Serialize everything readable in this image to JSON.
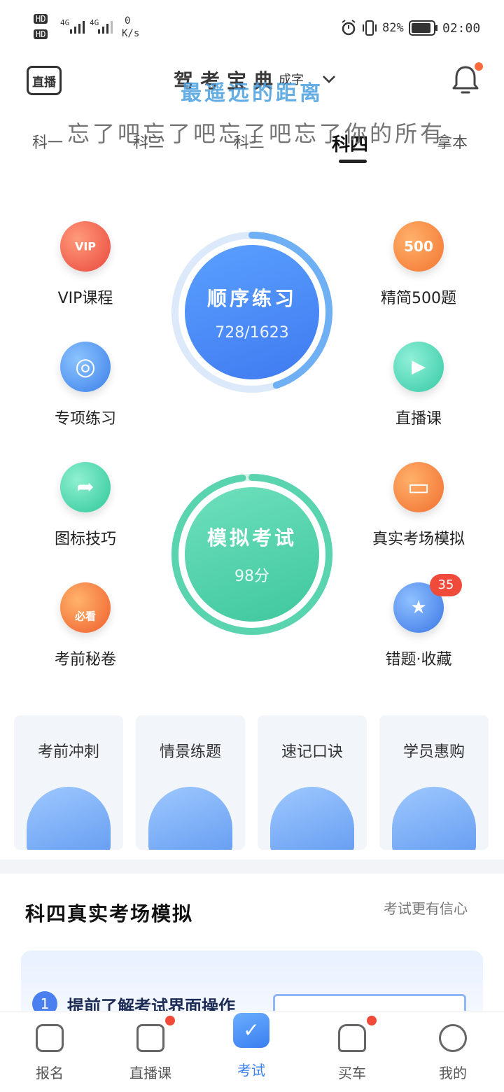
{
  "status_bar": {
    "hd1": "HD",
    "hd2": "HD",
    "net1": "4G",
    "net2": "4G",
    "speed_value": "0",
    "speed_unit": "K/s",
    "battery": "82%",
    "time": "02:00"
  },
  "header": {
    "live_label": "直播",
    "title": "驾考宝典",
    "title_overlay": "最遥远的距离",
    "title_sub": "成字"
  },
  "tabs": {
    "items": [
      "科一",
      "科二",
      "科三",
      "科四",
      "拿本"
    ],
    "active_index": 3,
    "overlay_text": "忘了吧忘了吧忘了吧忘了你的所有"
  },
  "features_left": [
    {
      "label": "VIP课程",
      "icon": "vip-medal-icon",
      "glyph": "VIP"
    },
    {
      "label": "专项练习",
      "icon": "target-icon",
      "glyph": "◎"
    },
    {
      "label": "图标技巧",
      "icon": "road-sign-icon",
      "glyph": "➦"
    },
    {
      "label": "考前秘卷",
      "icon": "exam-book-icon",
      "glyph": "必看"
    }
  ],
  "features_right": [
    {
      "label": "精简500题",
      "icon": "500-board-icon",
      "glyph": "500"
    },
    {
      "label": "直播课",
      "icon": "video-camera-icon",
      "glyph": "▶"
    },
    {
      "label": "真实考场模拟",
      "icon": "monitor-icon",
      "glyph": "▭"
    },
    {
      "label": "错题·收藏",
      "icon": "star-bookmark-icon",
      "glyph": "★",
      "badge": "35"
    }
  ],
  "practice": {
    "title": "顺序练习",
    "progress_text": "728/1623",
    "done": 728,
    "total": 1623
  },
  "mock_exam": {
    "title": "模拟考试",
    "score_text": "98分",
    "score": 98
  },
  "cards": [
    {
      "title": "考前冲刺"
    },
    {
      "title": "情景练题"
    },
    {
      "title": "速记口诀"
    },
    {
      "title": "学员惠购"
    }
  ],
  "section": {
    "title": "科四真实考场模拟",
    "more": "考试更有信心",
    "step_number": "1",
    "step_text": "提前了解考试界面操作"
  },
  "bottom_nav": [
    {
      "label": "报名",
      "icon": "signup-icon"
    },
    {
      "label": "直播课",
      "icon": "tv-icon",
      "dot": true
    },
    {
      "label": "考试",
      "icon": "check-icon",
      "active": true
    },
    {
      "label": "买车",
      "icon": "car-icon",
      "dot": true
    },
    {
      "label": "我的",
      "icon": "profile-icon"
    }
  ],
  "colors": {
    "accent_blue": "#3f7af0",
    "accent_green": "#3fc79d",
    "badge_red": "#f04a3a"
  }
}
